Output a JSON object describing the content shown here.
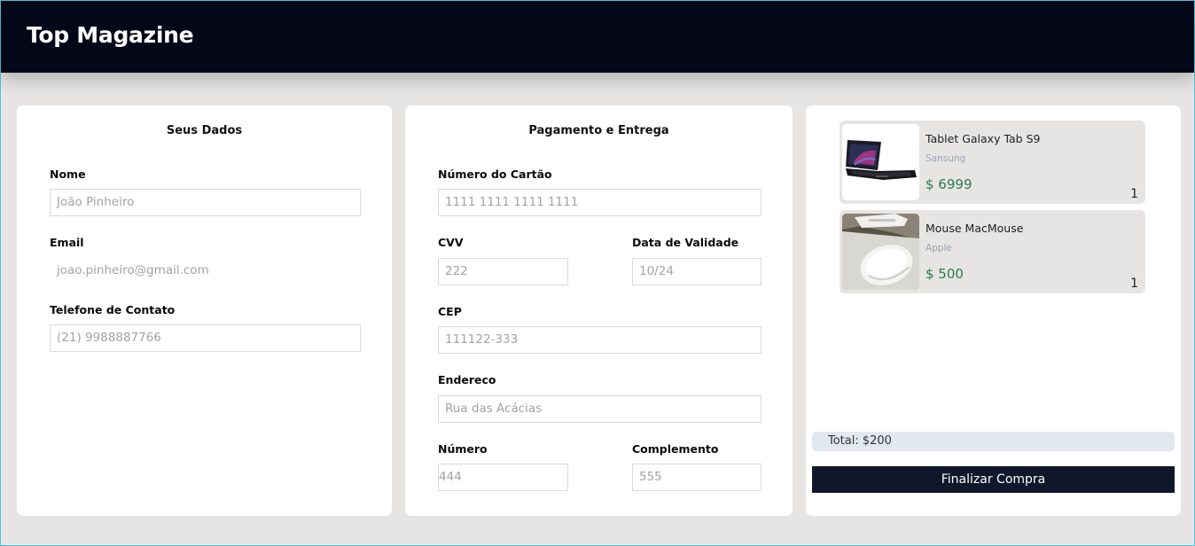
{
  "header": {
    "title": "Top Magazine"
  },
  "personal": {
    "title": "Seus Dados",
    "fields": {
      "name": {
        "label": "Nome",
        "placeholder": "João Pinheiro"
      },
      "email": {
        "label": "Email",
        "placeholder": "joao.pinheiro@gmail.com"
      },
      "phone": {
        "label": "Telefone de Contato",
        "placeholder": "(21) 9988887766"
      }
    }
  },
  "payment": {
    "title": "Pagamento e Entrega",
    "fields": {
      "card": {
        "label": "Número do Cartão",
        "placeholder": "1111 1111 1111 1111"
      },
      "cvv": {
        "label": "CVV",
        "placeholder": "222"
      },
      "expiry": {
        "label": "Data de Validade",
        "placeholder": "10/24"
      },
      "cep": {
        "label": "CEP",
        "placeholder": "111122-333"
      },
      "address": {
        "label": "Endereco",
        "placeholder": "Rua das Acácias"
      },
      "number": {
        "label": "Número",
        "placeholder": "444"
      },
      "complement": {
        "label": "Complemento",
        "placeholder": "555"
      }
    }
  },
  "cart": {
    "items": [
      {
        "name": "Tablet Galaxy Tab S9",
        "brand": "Sansung",
        "price": "$ 6999",
        "qty": "1",
        "image": "tablet-keyboard-image"
      },
      {
        "name": "Mouse MacMouse",
        "brand": "Apple",
        "price": "$ 500",
        "qty": "1",
        "image": "white-mouse-image"
      }
    ],
    "total": "Total: $200",
    "button": "Finalizar Compra"
  },
  "colors": {
    "header_bg": "#030718",
    "page_bg": "#e6e5e3",
    "price": "#2e7a4c",
    "button_bg": "#0f172a",
    "total_bg": "#e2e8f0"
  }
}
